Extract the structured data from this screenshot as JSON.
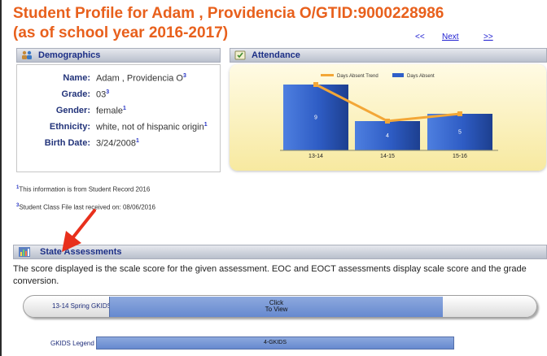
{
  "header": {
    "title_line1": "Student Profile for Adam , Providencia O/GTID:9000228986",
    "title_line2": "(as of school year 2016-2017)",
    "pager": {
      "prev": "<<",
      "next": "Next",
      "last": ">>"
    }
  },
  "demographics": {
    "section_title": "Demographics",
    "icon": "users-icon",
    "fields": [
      {
        "label": "Name:",
        "value": "Adam , Providencia O",
        "sup": "3"
      },
      {
        "label": "Grade:",
        "value": "03",
        "sup": "3"
      },
      {
        "label": "Gender:",
        "value": "female",
        "sup": "1"
      },
      {
        "label": "Ethnicity:",
        "value": "white, not of hispanic origin",
        "sup": "1"
      },
      {
        "label": "Birth Date:",
        "value": "3/24/2008",
        "sup": "1"
      }
    ]
  },
  "attendance": {
    "section_title": "Attendance",
    "icon": "calendar-icon"
  },
  "chart_data": {
    "type": "bar",
    "categories": [
      "13-14",
      "14-15",
      "15-16"
    ],
    "series": [
      {
        "name": "Days Absent",
        "type": "bar",
        "values": [
          9,
          4,
          5
        ],
        "color": "#2f5fc8"
      },
      {
        "name": "Days Absent Trend",
        "type": "line",
        "values": [
          9,
          4,
          5
        ],
        "color": "#f3a737"
      }
    ],
    "legend_position": "top",
    "grid": false
  },
  "footnotes": {
    "note1_num": "1",
    "note1_text": "This information is from Student Record 2016",
    "note3_num": "3",
    "note3_text": "Student Class File last received on: 08/06/2016"
  },
  "state_assessments": {
    "section_title": "State Assessments",
    "icon": "bar-chart-icon",
    "description": "The score displayed is the scale score for the given assessment. EOC and EOCT assessments display scale score and the grade conversion.",
    "rows": [
      {
        "label": "13-14 Spring GKIDS",
        "action_line1": "Click",
        "action_line2": "To View"
      }
    ],
    "legend": {
      "label": "GKIDS Legend",
      "bar_text": "4-GKIDS"
    }
  },
  "colors": {
    "title": "#e8601c",
    "section_text": "#1c2f86",
    "bar_blue": "#2f5fc8",
    "trend_orange": "#f3a737",
    "annotation_arrow": "#e8301c"
  }
}
